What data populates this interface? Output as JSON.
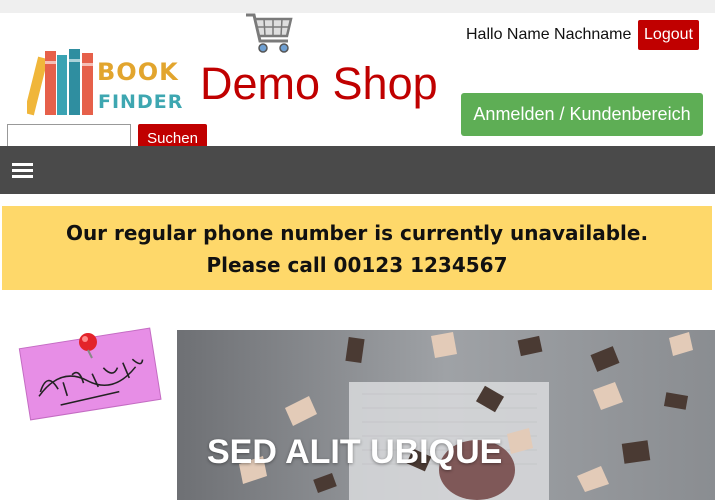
{
  "header": {
    "shop_title": "Demo Shop",
    "greeting": "Hallo Name Nachname",
    "logout_label": "Logout",
    "login_label": "Anmelden / Kundenbereich",
    "logo": {
      "word1": "BOOK",
      "word2": "FINDER"
    }
  },
  "search": {
    "placeholder": "",
    "value": "",
    "button_label": "Suchen"
  },
  "nav": {
    "menu_icon": "hamburger-menu-icon"
  },
  "notice": {
    "line1": "Our regular phone number is currently unavailable.",
    "line2": "Please call 00123 1234567"
  },
  "sidebar": {
    "sticky_note_text": "Important"
  },
  "banner": {
    "heading": "SED ALIT UBIQUE"
  },
  "colors": {
    "brand_red": "#c00000",
    "login_green": "#5eae55",
    "notice_yellow": "#fed86a",
    "navbar_gray": "#4a4a4a"
  }
}
